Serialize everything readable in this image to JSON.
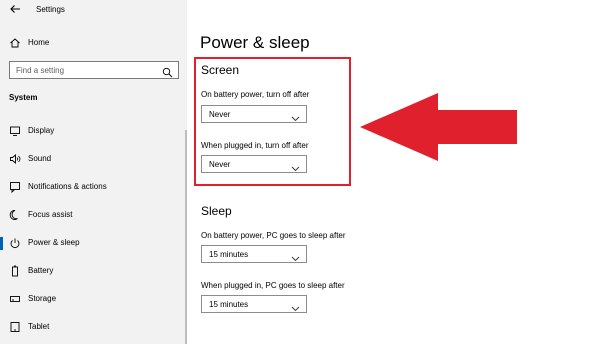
{
  "window": {
    "app_title": "Settings"
  },
  "sidebar": {
    "home_label": "Home",
    "search_placeholder": "Find a setting",
    "section_label": "System",
    "items": [
      {
        "label": "Display",
        "icon": "display-icon"
      },
      {
        "label": "Sound",
        "icon": "sound-icon"
      },
      {
        "label": "Notifications & actions",
        "icon": "notifications-icon"
      },
      {
        "label": "Focus assist",
        "icon": "focus-assist-icon"
      },
      {
        "label": "Power & sleep",
        "icon": "power-icon",
        "active": true
      },
      {
        "label": "Battery",
        "icon": "battery-icon"
      },
      {
        "label": "Storage",
        "icon": "storage-icon"
      },
      {
        "label": "Tablet",
        "icon": "tablet-icon"
      }
    ]
  },
  "main": {
    "title": "Power & sleep",
    "screen": {
      "title": "Screen",
      "battery_label": "On battery power, turn off after",
      "battery_value": "Never",
      "plugged_label": "When plugged in, turn off after",
      "plugged_value": "Never"
    },
    "sleep": {
      "title": "Sleep",
      "battery_label": "On battery power, PC goes to sleep after",
      "battery_value": "15 minutes",
      "plugged_label": "When plugged in, PC goes to sleep after",
      "plugged_value": "15 minutes"
    }
  },
  "colors": {
    "accent": "#0063b1",
    "highlight": "#e0202c",
    "sidebar_bg": "#f2f2f2"
  }
}
